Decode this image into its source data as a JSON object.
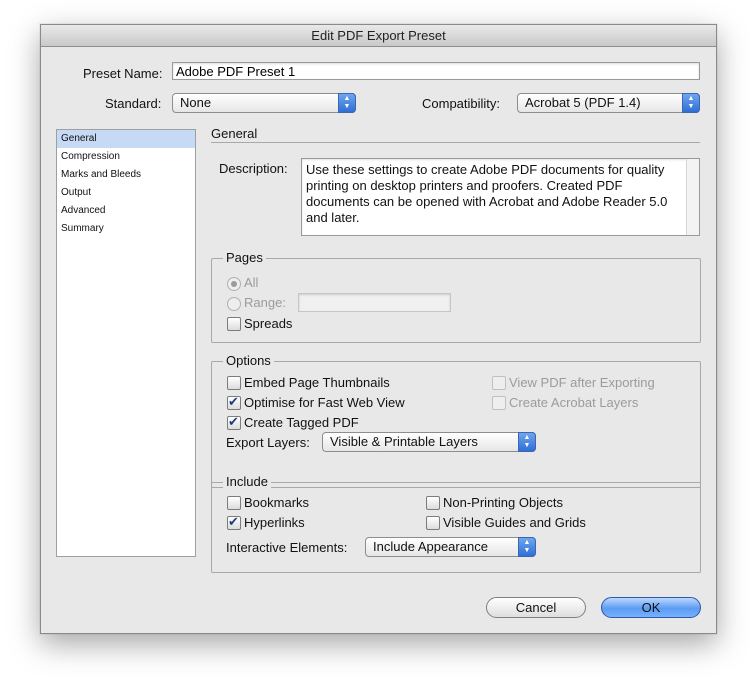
{
  "window": {
    "title": "Edit PDF Export Preset"
  },
  "preset": {
    "label": "Preset Name:",
    "value": "Adobe PDF Preset 1"
  },
  "standard": {
    "label": "Standard:",
    "value": "None"
  },
  "compatibility": {
    "label": "Compatibility:",
    "value": "Acrobat 5 (PDF 1.4)"
  },
  "sidebar": {
    "items": [
      {
        "label": "General",
        "selected": true
      },
      {
        "label": "Compression",
        "selected": false
      },
      {
        "label": "Marks and Bleeds",
        "selected": false
      },
      {
        "label": "Output",
        "selected": false
      },
      {
        "label": "Advanced",
        "selected": false
      },
      {
        "label": "Summary",
        "selected": false
      }
    ]
  },
  "general": {
    "heading": "General",
    "description_label": "Description:",
    "description": "Use these settings to create Adobe PDF documents for quality printing on desktop printers and proofers.  Created PDF documents can be opened with Acrobat and Adobe Reader 5.0 and later."
  },
  "pages": {
    "title": "Pages",
    "all_label": "All",
    "all_selected": true,
    "range_label": "Range:",
    "range_value": "",
    "spreads_label": "Spreads",
    "spreads_checked": false
  },
  "options": {
    "title": "Options",
    "embed_thumbnails": {
      "label": "Embed Page Thumbnails",
      "checked": false
    },
    "optimise_web": {
      "label": "Optimise for Fast Web View",
      "checked": true
    },
    "tagged_pdf": {
      "label": "Create Tagged PDF",
      "checked": true
    },
    "view_after": {
      "label": "View PDF after Exporting",
      "checked": false,
      "enabled": false
    },
    "acrobat_layers": {
      "label": "Create Acrobat Layers",
      "checked": false,
      "enabled": false
    },
    "export_layers_label": "Export Layers:",
    "export_layers_value": "Visible & Printable Layers"
  },
  "include": {
    "title": "Include",
    "bookmarks": {
      "label": "Bookmarks",
      "checked": false
    },
    "hyperlinks": {
      "label": "Hyperlinks",
      "checked": true
    },
    "non_printing": {
      "label": "Non-Printing Objects",
      "checked": false
    },
    "guides_grids": {
      "label": "Visible Guides and Grids",
      "checked": false
    },
    "interactive_label": "Interactive Elements:",
    "interactive_value": "Include Appearance"
  },
  "buttons": {
    "cancel": "Cancel",
    "ok": "OK"
  },
  "colors": {
    "accent": "#5b9cf2",
    "selection": "#c6d9f5"
  },
  "icons": {
    "popup_arrows": "updown-arrows-icon",
    "checkmark": "checkmark-icon"
  }
}
